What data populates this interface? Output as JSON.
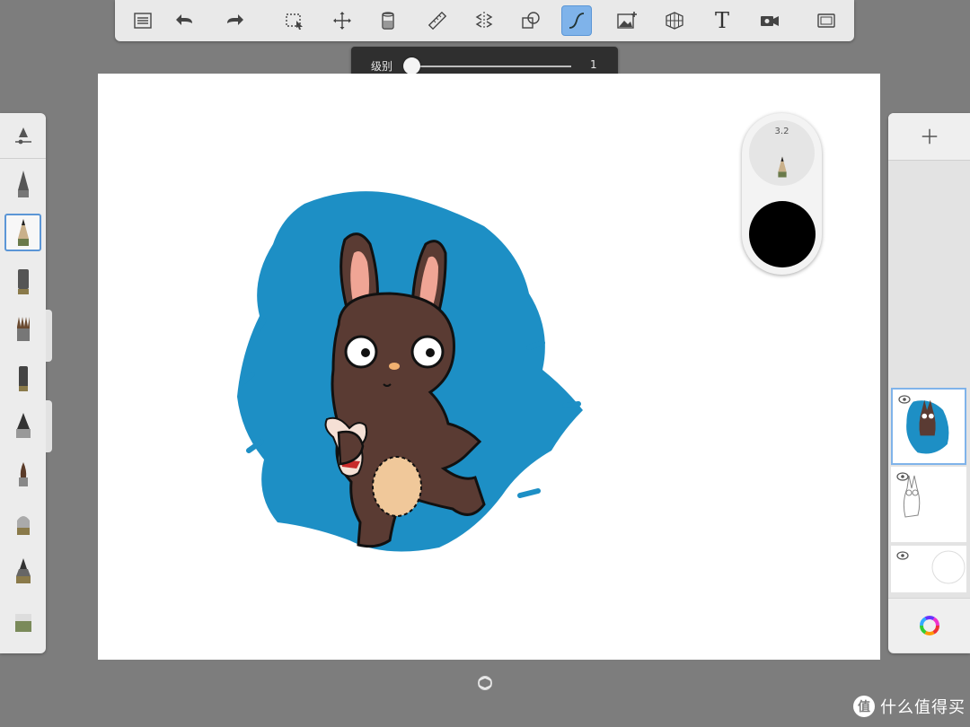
{
  "toolbar": {
    "tools": [
      {
        "name": "list-icon"
      },
      {
        "name": "undo-icon"
      },
      {
        "name": "redo-icon"
      },
      {
        "name": "selection-icon"
      },
      {
        "name": "transform-icon"
      },
      {
        "name": "fill-icon"
      },
      {
        "name": "ruler-icon"
      },
      {
        "name": "symmetry-icon"
      },
      {
        "name": "shapes-icon"
      },
      {
        "name": "stroke-smoothing-icon"
      },
      {
        "name": "import-image-icon"
      },
      {
        "name": "perspective-icon"
      },
      {
        "name": "text-icon",
        "glyph": "T"
      },
      {
        "name": "record-icon"
      },
      {
        "name": "fullscreen-icon"
      }
    ],
    "active_tool": "stroke-smoothing-icon"
  },
  "level_slider": {
    "label": "级别",
    "value": "1",
    "fraction": 0
  },
  "brush_puck": {
    "size": "3.2",
    "color": "#000000"
  },
  "brushes": {
    "selected_index": 1,
    "items": [
      "pencil-brush-icon",
      "pencil-brush-icon",
      "marker-brush-icon",
      "paint-brush-icon",
      "pen-brush-icon",
      "airbrush-icon",
      "brush-tip-icon",
      "smudge-icon",
      "fill-brush-icon",
      "eraser-icon"
    ]
  },
  "layers": {
    "items": [
      {
        "name": "layer-colored",
        "visible": true,
        "selected": true
      },
      {
        "name": "layer-sketch",
        "visible": true,
        "selected": false
      },
      {
        "name": "layer-background",
        "visible": true,
        "selected": false
      }
    ]
  },
  "colors": {
    "accent": "#7fb3ea",
    "panel": "#ececec",
    "background": "#7d7d7d",
    "blue_scribble": "#1d8fc5",
    "rabbit_brown": "#5a3b33",
    "ear_inner": "#f0a595",
    "belly": "#f0c89a"
  },
  "watermark": {
    "text": "什么值得买",
    "logo": "值"
  }
}
